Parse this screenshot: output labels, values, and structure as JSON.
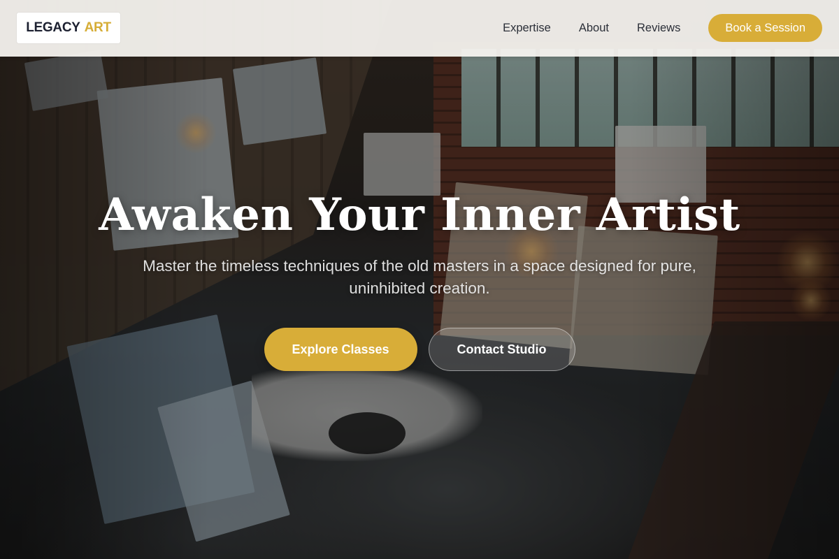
{
  "brand": {
    "name_primary": "LEGACY",
    "name_accent": "ART",
    "primary_color": "#1c2030",
    "accent_color": "#d8ad38"
  },
  "nav": {
    "links": [
      {
        "label": "Expertise"
      },
      {
        "label": "About"
      },
      {
        "label": "Reviews"
      }
    ],
    "cta_label": "Book a Session"
  },
  "hero": {
    "title": "Awaken Your Inner Artist",
    "subtitle": "Master the timeless techniques of the old masters in a space designed for pure, uninhibited creation.",
    "primary_button": "Explore Classes",
    "secondary_button": "Contact Studio",
    "background_image": "art-studio-photo"
  }
}
